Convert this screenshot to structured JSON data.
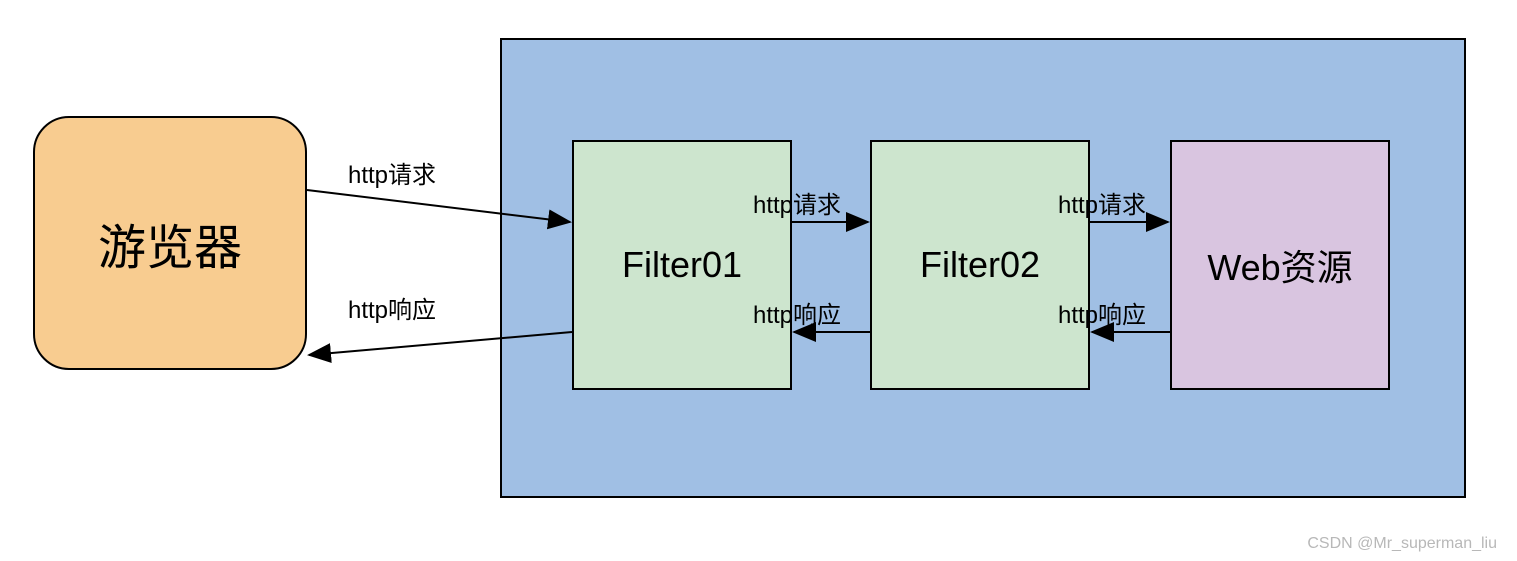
{
  "nodes": {
    "browser": "游览器",
    "filter01": "Filter01",
    "filter02": "Filter02",
    "webres": "Web资源"
  },
  "labels": {
    "req1": "http请求",
    "req2": "http请求",
    "req3": "http请求",
    "res1": "http响应",
    "res2": "http响应",
    "res3": "http响应"
  },
  "watermark": "CSDN @Mr_superman_liu"
}
